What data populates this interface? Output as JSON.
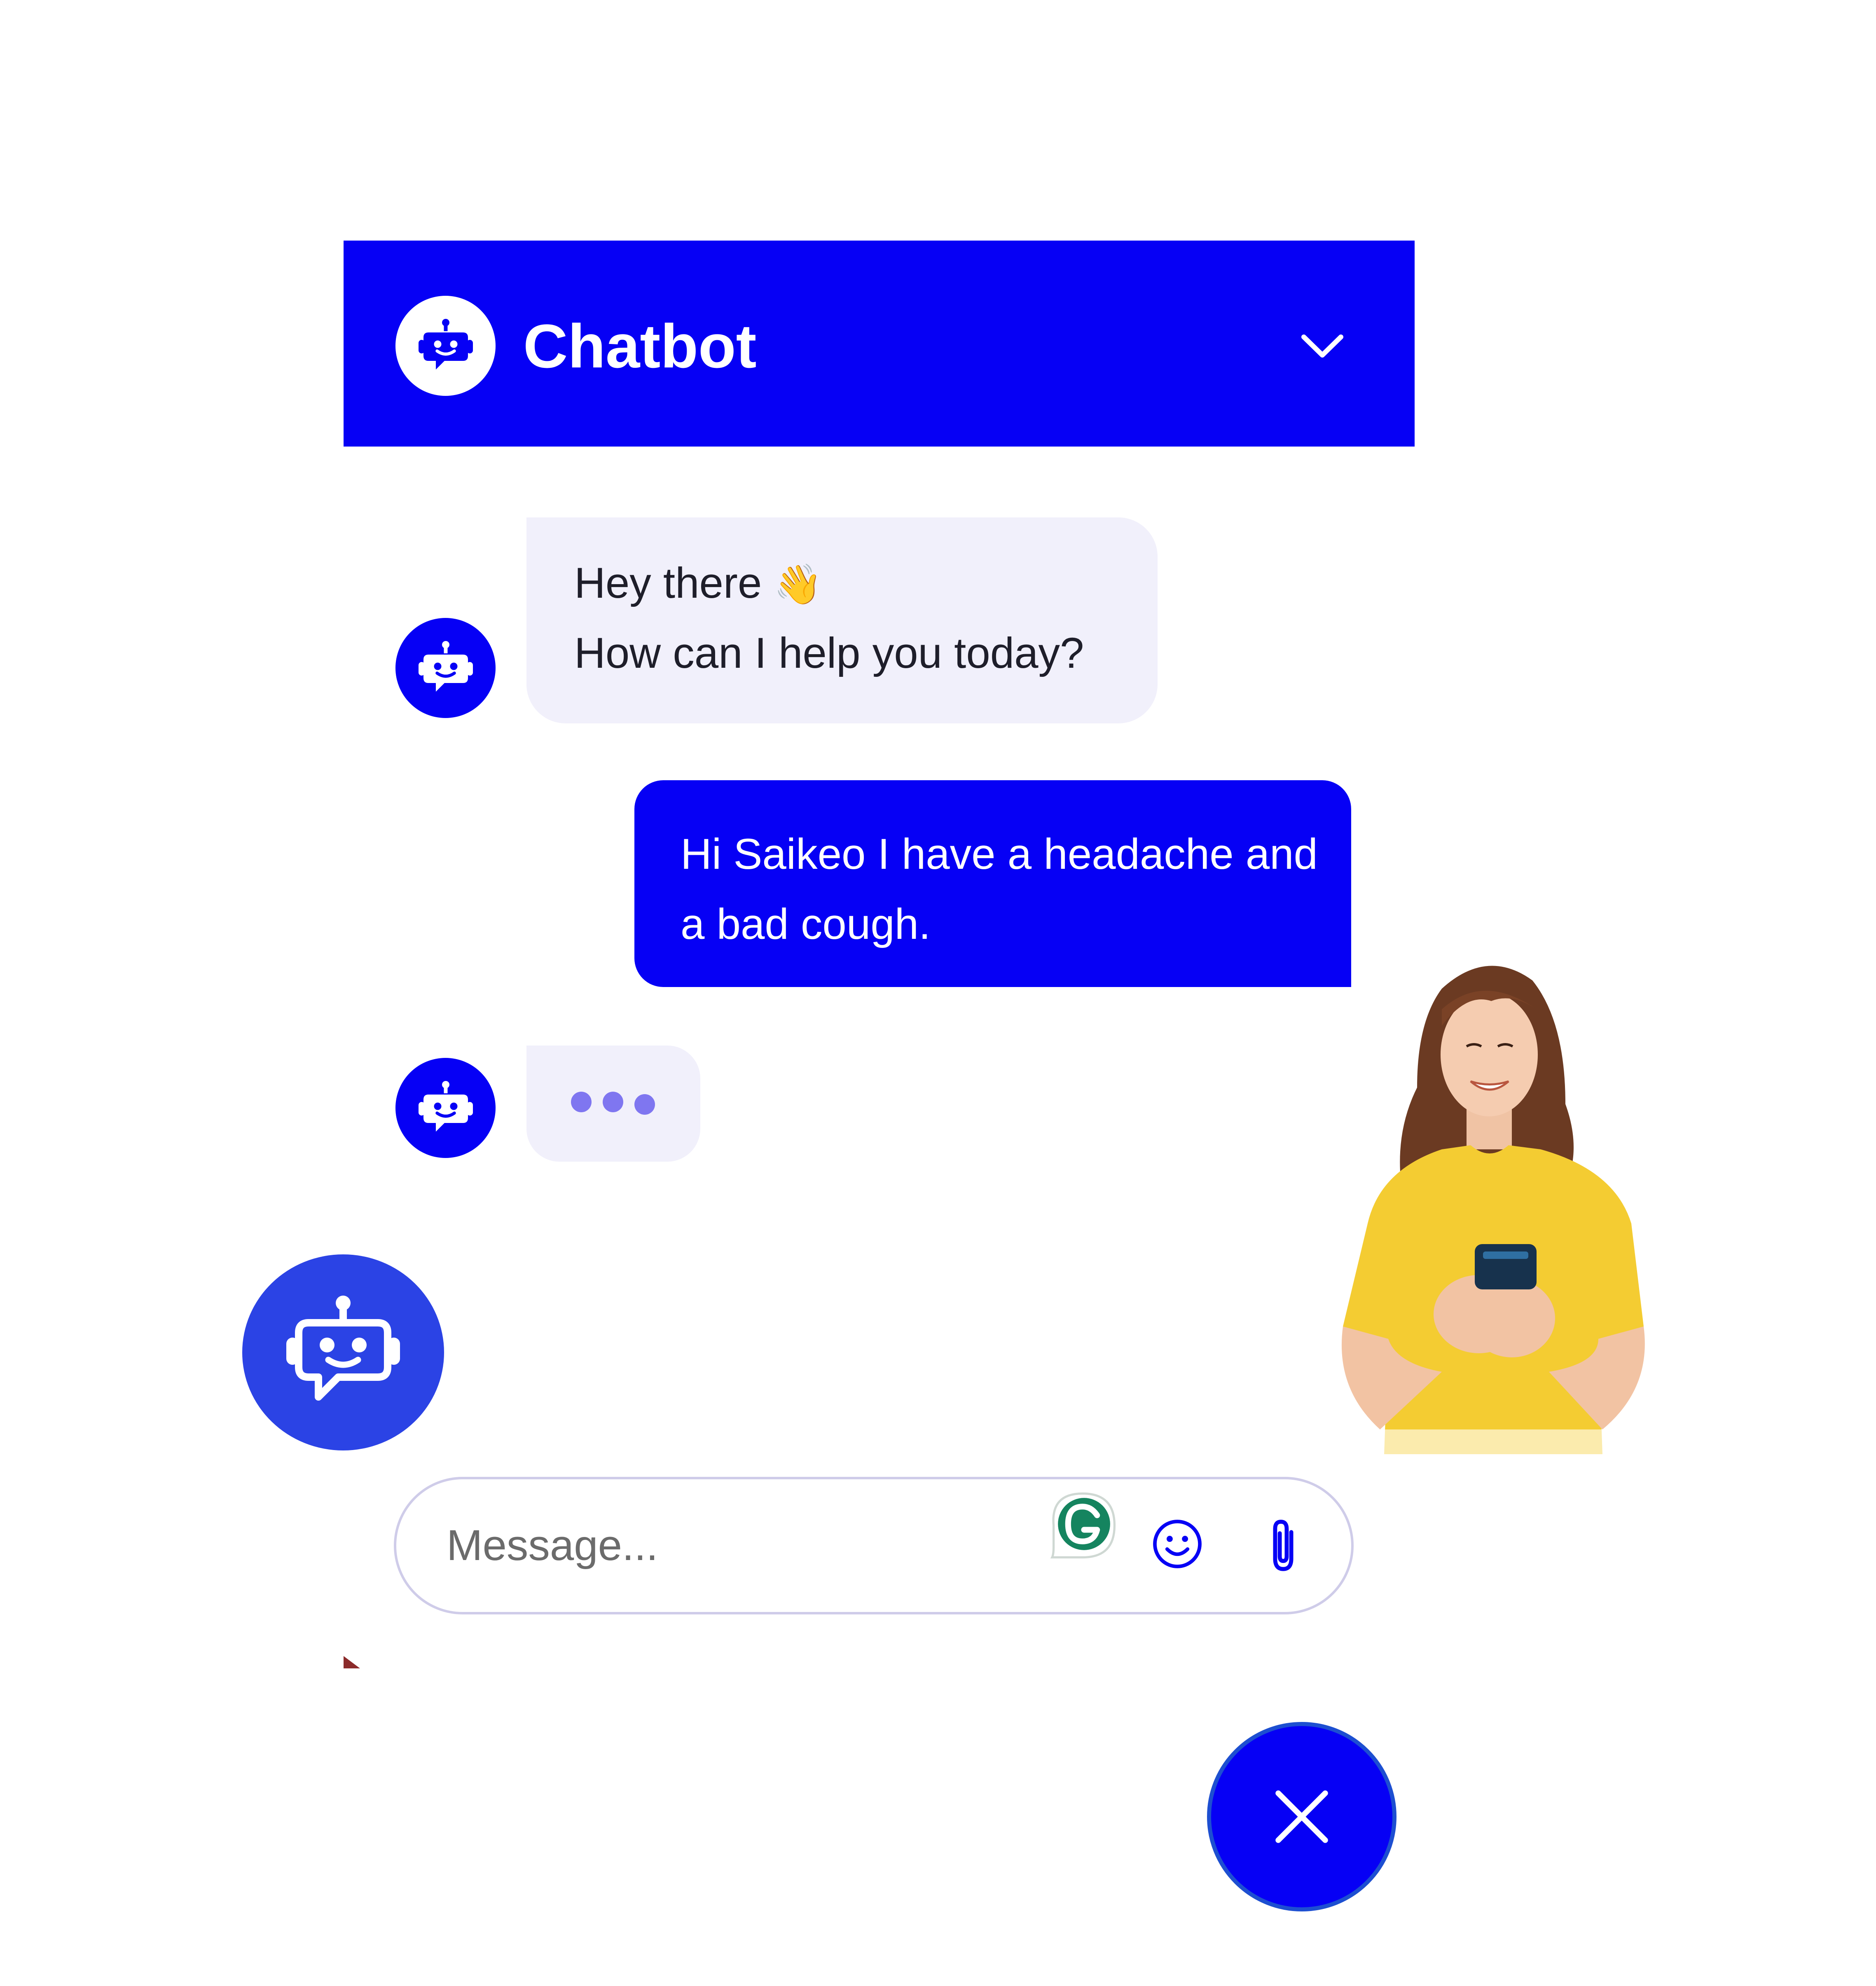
{
  "header": {
    "title": "Chatbot",
    "avatar_icon": "robot-chat-icon",
    "collapse_icon": "chevron-down-icon",
    "background_color": "#0600f5"
  },
  "messages": [
    {
      "sender": "bot",
      "lines": [
        "Hey there",
        "How can I help you today?"
      ],
      "emoji": "👋"
    },
    {
      "sender": "user",
      "text": "Hi Saikeo I have a headache and a bad cough."
    },
    {
      "sender": "bot",
      "typing": true
    }
  ],
  "composer": {
    "placeholder": "Message...",
    "grammarly_icon": "grammarly-icon",
    "emoji_icon": "smiley-icon",
    "attach_icon": "paperclip-icon"
  },
  "launcher": {
    "icon": "robot-chat-icon",
    "color": "#2b43e5"
  },
  "close_button": {
    "icon": "close-icon",
    "color": "#0600f5"
  },
  "illustration": "woman-using-phone"
}
